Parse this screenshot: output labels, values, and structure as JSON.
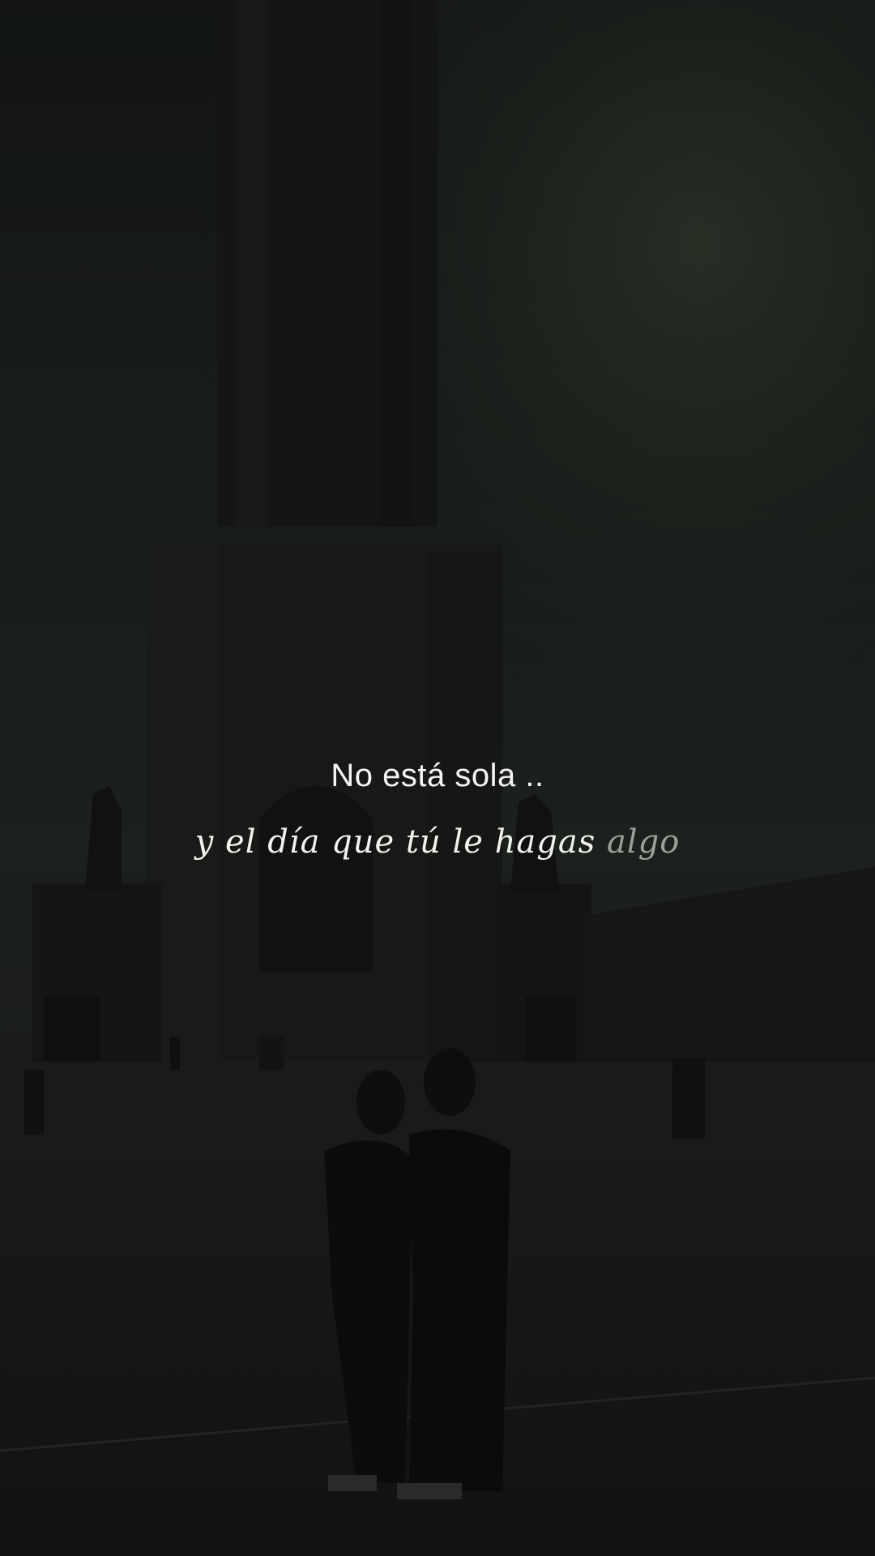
{
  "scene": {
    "description_icon": "monument-photo-icon"
  },
  "captions": {
    "line1": "No está sola ..",
    "line2_main": "y el día que tú le hagas ",
    "line2_faded": "algo"
  }
}
